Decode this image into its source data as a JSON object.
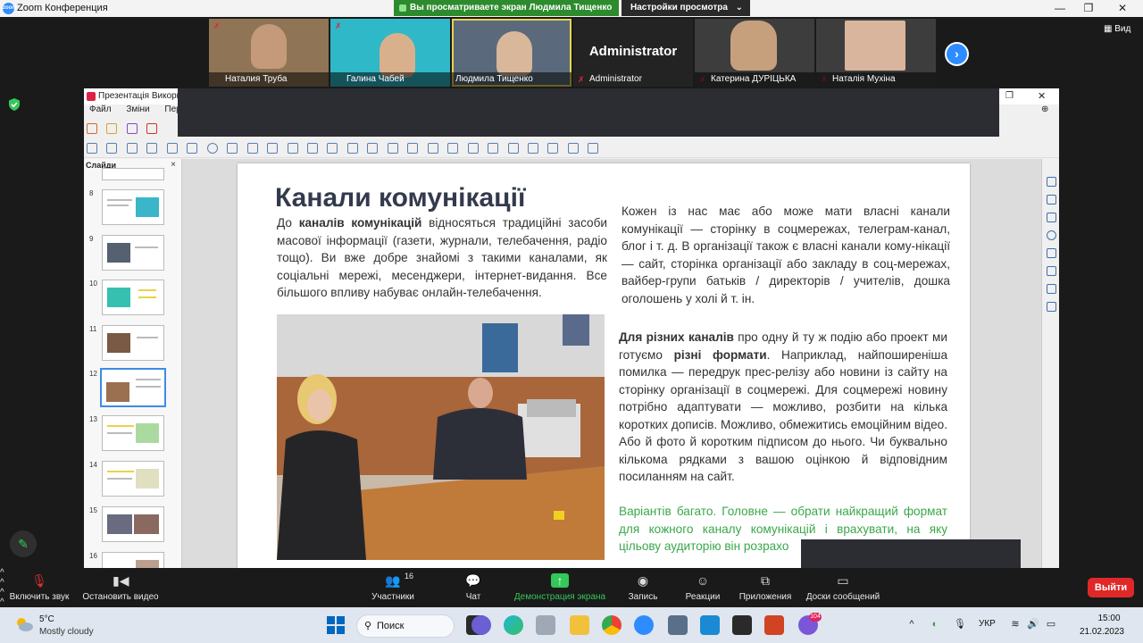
{
  "zoom": {
    "window_title": "Zoom Конференция",
    "share_banner": "Вы просматриваете экран Людмила Тищенко",
    "view_options": "Настройки просмотра",
    "view_button": "Вид",
    "participants": [
      {
        "name": "Наталия Труба"
      },
      {
        "name": "Галина Чабей"
      },
      {
        "name": "Людмила Тищенко"
      },
      {
        "name": "Administrator",
        "big_label": "Administrator"
      },
      {
        "name": "Катерина ДУРІЦЬКА"
      },
      {
        "name": "Наталія Мухіна"
      }
    ],
    "controls": {
      "audio": "Включить звук",
      "video": "Остановить видео",
      "participants": "Участники",
      "participants_count": "16",
      "chat": "Чат",
      "share": "Демонстрация экрана",
      "record": "Запись",
      "reactions": "Реакции",
      "apps": "Приложения",
      "whiteboards": "Доски сообщений",
      "leave": "Выйти"
    },
    "accent": "#2d8cff",
    "share_color": "#34c759",
    "leave_color": "#e02828"
  },
  "impress": {
    "window_title": "Презентація Використ",
    "menu": [
      "Файл",
      "Зміни",
      "Перегля"
    ],
    "slides_panel_title": "Слайди",
    "slide_numbers": [
      "8",
      "9",
      "10",
      "11",
      "12",
      "13",
      "14",
      "15",
      "16"
    ],
    "selected_slide": "12",
    "slide": {
      "title": "Канали комунікації",
      "para1_intro": "До ",
      "para1_bold": "каналів комунікацій",
      "para1_rest": " відносяться традиційні засоби масової інформації (газети, журнали, телебачення, радіо тощо). Ви вже добре знайомі з такими каналами, як соціальні мережі, месенджери, інтернет-видання. Все більшого впливу набуває онлайн-телебачення.",
      "para2": "Кожен із нас має або може мати власні канали комунікації — сторінку в соцмережах, телеграм-канал, блог і т. д. В організації також є власні канали кому-нікації — сайт, сторінка організації або закладу в соц-мережах, вайбер-групи батьків / директорів / учителів, дошка оголошень у холі й т. ін.",
      "para3_bold1": "Для різних каналів",
      "para3_mid": " про одну й ту ж подію або проект ми готуємо ",
      "para3_bold2": "різні формати",
      "para3_rest": ". Наприклад, найпоширеніша помилка — передрук прес-релізу або новини із сайту на сторінку організації в соцмережі. Для соцмережі новину потрібно адаптувати — можливо, розбити на кілька коротких дописів. Можливо, обмежитись емоційним відео. Або й фото й коротким підписом до нього. Чи буквально кількома рядками з вашою оцінкою й відповідним посиланням на сайт.",
      "para4": "Варіантів багато. Головне — обрати найкращий формат для кожного каналу комунікацій і врахувати, на яку цільову аудиторію він розрахо"
    }
  },
  "taskbar": {
    "weather_temp": "5°C",
    "weather_desc": "Mostly cloudy",
    "search": "Поиск",
    "lang": "УКР",
    "time": "15:00",
    "date": "21.02.2023",
    "badge": "104"
  }
}
